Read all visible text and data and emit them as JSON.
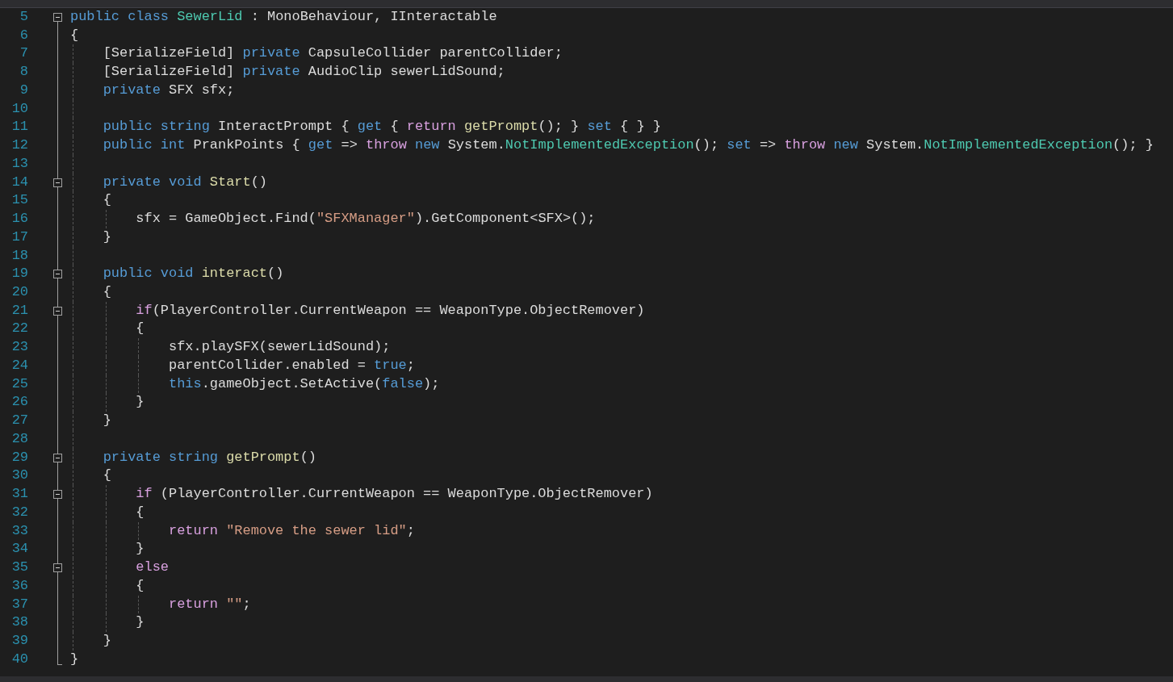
{
  "editor": {
    "lines": [
      {
        "number": "5",
        "foldable": true,
        "tokens": [
          {
            "kind": "kw",
            "text": "public"
          },
          {
            "kind": "kw",
            "text": " class"
          },
          {
            "kind": "type",
            "text": " SewerLid"
          },
          {
            "kind": "plain",
            "text": " : MonoBehaviour, IInteractable"
          }
        ]
      },
      {
        "number": "6",
        "tokens": [
          {
            "kind": "plain",
            "text": "{"
          }
        ]
      },
      {
        "number": "7",
        "tokens": [
          {
            "kind": "plain",
            "text": "    [SerializeField]"
          },
          {
            "kind": "kw",
            "text": " private"
          },
          {
            "kind": "plain",
            "text": " CapsuleCollider parentCollider;"
          }
        ]
      },
      {
        "number": "8",
        "tokens": [
          {
            "kind": "plain",
            "text": "    [SerializeField]"
          },
          {
            "kind": "kw",
            "text": " private"
          },
          {
            "kind": "plain",
            "text": " AudioClip sewerLidSound;"
          }
        ]
      },
      {
        "number": "9",
        "tokens": [
          {
            "kind": "kw",
            "text": "    private"
          },
          {
            "kind": "plain",
            "text": " SFX sfx;"
          }
        ]
      },
      {
        "number": "10"
      },
      {
        "number": "11",
        "tokens": [
          {
            "kind": "kw",
            "text": "    public"
          },
          {
            "kind": "kw",
            "text": " string"
          },
          {
            "kind": "plain",
            "text": " InteractPrompt {"
          },
          {
            "kind": "kw",
            "text": " get"
          },
          {
            "kind": "plain",
            "text": " {"
          },
          {
            "kind": "ctrl",
            "text": " return"
          },
          {
            "kind": "method",
            "text": " getPrompt"
          },
          {
            "kind": "plain",
            "text": "(); }"
          },
          {
            "kind": "kw",
            "text": " set"
          },
          {
            "kind": "plain",
            "text": " { } }"
          }
        ]
      },
      {
        "number": "12",
        "tokens": [
          {
            "kind": "kw",
            "text": "    public"
          },
          {
            "kind": "kw",
            "text": " int"
          },
          {
            "kind": "plain",
            "text": " PrankPoints {"
          },
          {
            "kind": "kw",
            "text": " get"
          },
          {
            "kind": "plain",
            "text": " =>"
          },
          {
            "kind": "ctrl",
            "text": " throw"
          },
          {
            "kind": "kw",
            "text": " new"
          },
          {
            "kind": "plain",
            "text": " System."
          },
          {
            "kind": "type",
            "text": "NotImplementedException"
          },
          {
            "kind": "plain",
            "text": "();"
          },
          {
            "kind": "kw",
            "text": " set"
          },
          {
            "kind": "plain",
            "text": " =>"
          },
          {
            "kind": "ctrl",
            "text": " throw"
          },
          {
            "kind": "kw",
            "text": " new"
          },
          {
            "kind": "plain",
            "text": " System."
          },
          {
            "kind": "type",
            "text": "NotImplementedException"
          },
          {
            "kind": "plain",
            "text": "(); }"
          }
        ]
      },
      {
        "number": "13"
      },
      {
        "number": "14",
        "foldable": true,
        "tokens": [
          {
            "kind": "kw",
            "text": "    private"
          },
          {
            "kind": "kw",
            "text": " void"
          },
          {
            "kind": "method",
            "text": " Start"
          },
          {
            "kind": "plain",
            "text": "()"
          }
        ]
      },
      {
        "number": "15",
        "tokens": [
          {
            "kind": "plain",
            "text": "    {"
          }
        ]
      },
      {
        "number": "16",
        "tokens": [
          {
            "kind": "plain",
            "text": "        sfx = GameObject.Find("
          },
          {
            "kind": "str",
            "text": "\"SFXManager\""
          },
          {
            "kind": "plain",
            "text": ").GetComponent<SFX>();"
          }
        ]
      },
      {
        "number": "17",
        "tokens": [
          {
            "kind": "plain",
            "text": "    }"
          }
        ]
      },
      {
        "number": "18"
      },
      {
        "number": "19",
        "foldable": true,
        "tokens": [
          {
            "kind": "kw",
            "text": "    public"
          },
          {
            "kind": "kw",
            "text": " void"
          },
          {
            "kind": "method",
            "text": " interact"
          },
          {
            "kind": "plain",
            "text": "()"
          }
        ]
      },
      {
        "number": "20",
        "tokens": [
          {
            "kind": "plain",
            "text": "    {"
          }
        ]
      },
      {
        "number": "21",
        "foldable": true,
        "tokens": [
          {
            "kind": "ctrl",
            "text": "        if"
          },
          {
            "kind": "plain",
            "text": "(PlayerController.CurrentWeapon == WeaponType.ObjectRemover)"
          }
        ]
      },
      {
        "number": "22",
        "tokens": [
          {
            "kind": "plain",
            "text": "        {"
          }
        ]
      },
      {
        "number": "23",
        "tokens": [
          {
            "kind": "plain",
            "text": "            sfx.playSFX(sewerLidSound);"
          }
        ]
      },
      {
        "number": "24",
        "tokens": [
          {
            "kind": "plain",
            "text": "            parentCollider.enabled ="
          },
          {
            "kind": "kw",
            "text": " true"
          },
          {
            "kind": "plain",
            "text": ";"
          }
        ]
      },
      {
        "number": "25",
        "tokens": [
          {
            "kind": "kw",
            "text": "            this"
          },
          {
            "kind": "plain",
            "text": ".gameObject.SetActive("
          },
          {
            "kind": "kw",
            "text": "false"
          },
          {
            "kind": "plain",
            "text": ");"
          }
        ]
      },
      {
        "number": "26",
        "tokens": [
          {
            "kind": "plain",
            "text": "        }"
          }
        ]
      },
      {
        "number": "27",
        "tokens": [
          {
            "kind": "plain",
            "text": "    }"
          }
        ]
      },
      {
        "number": "28"
      },
      {
        "number": "29",
        "foldable": true,
        "tokens": [
          {
            "kind": "kw",
            "text": "    private"
          },
          {
            "kind": "kw",
            "text": " string"
          },
          {
            "kind": "method",
            "text": " getPrompt"
          },
          {
            "kind": "plain",
            "text": "()"
          }
        ]
      },
      {
        "number": "30",
        "tokens": [
          {
            "kind": "plain",
            "text": "    {"
          }
        ]
      },
      {
        "number": "31",
        "foldable": true,
        "tokens": [
          {
            "kind": "ctrl",
            "text": "        if"
          },
          {
            "kind": "plain",
            "text": " (PlayerController.CurrentWeapon == WeaponType.ObjectRemover)"
          }
        ]
      },
      {
        "number": "32",
        "tokens": [
          {
            "kind": "plain",
            "text": "        {"
          }
        ]
      },
      {
        "number": "33",
        "tokens": [
          {
            "kind": "ctrl",
            "text": "            return"
          },
          {
            "kind": "str",
            "text": " \"Remove the sewer lid\""
          },
          {
            "kind": "plain",
            "text": ";"
          }
        ]
      },
      {
        "number": "34",
        "tokens": [
          {
            "kind": "plain",
            "text": "        }"
          }
        ]
      },
      {
        "number": "35",
        "foldable": true,
        "tokens": [
          {
            "kind": "ctrl",
            "text": "        else"
          }
        ]
      },
      {
        "number": "36",
        "tokens": [
          {
            "kind": "plain",
            "text": "        {"
          }
        ]
      },
      {
        "number": "37",
        "tokens": [
          {
            "kind": "ctrl",
            "text": "            return"
          },
          {
            "kind": "str",
            "text": " \"\""
          },
          {
            "kind": "plain",
            "text": ";"
          }
        ]
      },
      {
        "number": "38",
        "tokens": [
          {
            "kind": "plain",
            "text": "        }"
          }
        ]
      },
      {
        "number": "39",
        "tokens": [
          {
            "kind": "plain",
            "text": "    }"
          }
        ]
      },
      {
        "number": "40",
        "tokens": [
          {
            "kind": "plain",
            "text": "}"
          }
        ]
      }
    ]
  }
}
